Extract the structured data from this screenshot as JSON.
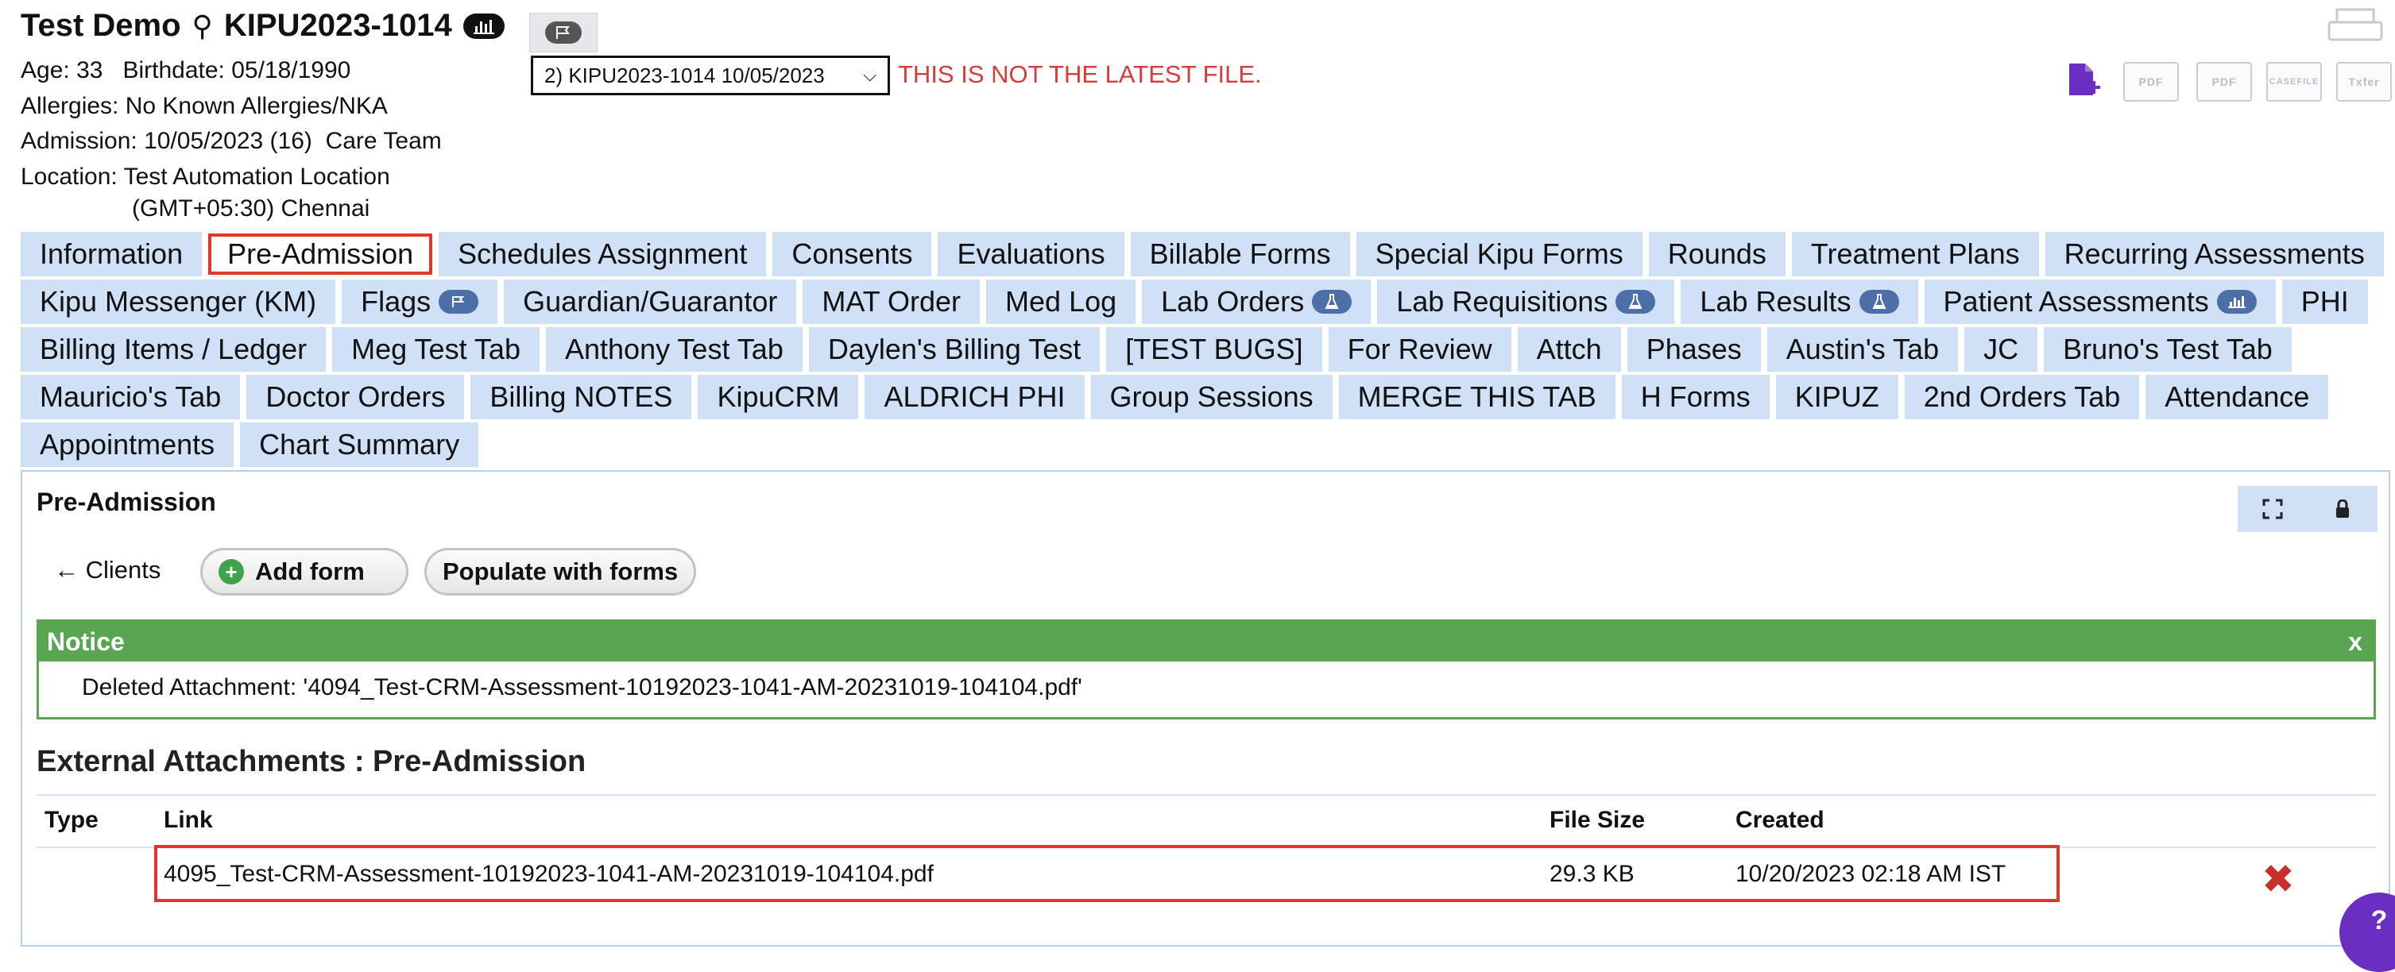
{
  "header": {
    "patient_name": "Test Demo",
    "chart_id": "KIPU2023-1014",
    "age_label": "Age:",
    "age": "33",
    "birthdate_label": "Birthdate:",
    "birthdate": "05/18/1990",
    "allergies_label": "Allergies:",
    "allergies": "No Known Allergies/NKA",
    "admission_label": "Admission:",
    "admission": "10/05/2023 (16)",
    "care_team": "Care Team",
    "location_label": "Location:",
    "location_line1": "Test Automation Location",
    "location_line2": "(GMT+05:30) Chennai",
    "file_select_value": "2) KIPU2023-1014 10/05/2023",
    "latest_warning": "THIS IS NOT THE LATEST FILE."
  },
  "toolbar": {
    "pdf_label": "PDF",
    "pdf2_label": "PDF",
    "casefile_label": "CASEFILE",
    "txfer_label": "Txfer"
  },
  "tabs": {
    "rows": [
      [
        {
          "label": "Information"
        },
        {
          "label": "Pre-Admission",
          "active": true
        },
        {
          "label": "Schedules Assignment"
        },
        {
          "label": "Consents"
        },
        {
          "label": "Evaluations"
        },
        {
          "label": "Billable Forms"
        },
        {
          "label": "Special Kipu Forms"
        },
        {
          "label": "Rounds"
        },
        {
          "label": "Treatment Plans"
        },
        {
          "label": "Recurring Assessments"
        }
      ],
      [
        {
          "label": "Kipu Messenger (KM)"
        },
        {
          "label": "Flags",
          "badge": "flag-icon"
        },
        {
          "label": "Guardian/Guarantor"
        },
        {
          "label": "MAT Order"
        },
        {
          "label": "Med Log"
        },
        {
          "label": "Lab Orders",
          "badge": "flask-icon"
        },
        {
          "label": "Lab Requisitions",
          "badge": "flask-icon"
        },
        {
          "label": "Lab Results",
          "badge": "flask-icon"
        },
        {
          "label": "Patient Assessments",
          "badge": "chart-icon"
        },
        {
          "label": "PHI"
        }
      ],
      [
        {
          "label": "Billing Items / Ledger"
        },
        {
          "label": "Meg Test Tab"
        },
        {
          "label": "Anthony Test Tab"
        },
        {
          "label": "Daylen's Billing Test"
        },
        {
          "label": "[TEST BUGS]"
        },
        {
          "label": "For Review"
        },
        {
          "label": "Attch"
        },
        {
          "label": "Phases"
        },
        {
          "label": "Austin's Tab"
        },
        {
          "label": "JC"
        },
        {
          "label": "Bruno's Test Tab"
        }
      ],
      [
        {
          "label": "Mauricio's Tab"
        },
        {
          "label": "Doctor Orders"
        },
        {
          "label": "Billing NOTES"
        },
        {
          "label": "KipuCRM"
        },
        {
          "label": "ALDRICH PHI"
        },
        {
          "label": "Group Sessions"
        },
        {
          "label": "MERGE THIS TAB"
        },
        {
          "label": "H Forms"
        },
        {
          "label": "KIPUZ"
        },
        {
          "label": "2nd Orders Tab"
        },
        {
          "label": "Attendance"
        }
      ],
      [
        {
          "label": "Appointments"
        },
        {
          "label": "Chart Summary"
        }
      ]
    ]
  },
  "panel": {
    "title": "Pre-Admission",
    "clients_link": "Clients",
    "add_form": "Add form",
    "populate": "Populate with forms"
  },
  "notice": {
    "title": "Notice",
    "close": "x",
    "message": "Deleted Attachment: '4094_Test-CRM-Assessment-10192023-1041-AM-20231019-104104.pdf'"
  },
  "attachments": {
    "heading": "External Attachments : Pre-Admission",
    "columns": {
      "type": "Type",
      "link": "Link",
      "size": "File Size",
      "created": "Created"
    },
    "rows": [
      {
        "type": "",
        "link": "4095_Test-CRM-Assessment-10192023-1041-AM-20231019-104104.pdf",
        "size": "29.3 KB",
        "created": "10/20/2023 02:18 AM IST"
      }
    ]
  },
  "colors": {
    "tab_bg": "#cfe0f7",
    "active_outline": "#e0362c",
    "notice_green": "#5aa552",
    "warning_red": "#d83b3b",
    "brand_purple": "#6a2fc2"
  }
}
